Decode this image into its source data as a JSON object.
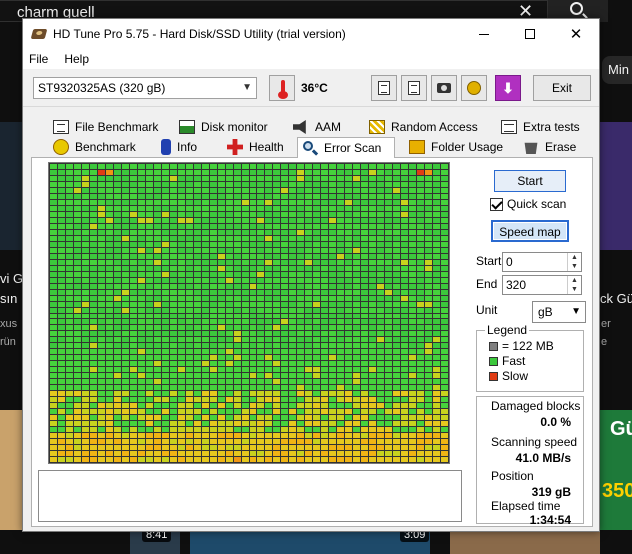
{
  "background": {
    "search_text": "charm guell",
    "chip_text": "Min",
    "left_video_title_1": "vi G",
    "left_video_title_2": "sın",
    "left_video_meta_1": "xus",
    "left_video_meta_2": "rün",
    "right_video_title": "ck Gü",
    "right_video_meta_1": "er",
    "right_video_meta_2": "e",
    "badge_left": "8:41",
    "badge_mid": "3:09",
    "right_thumb_text_1": "Gü",
    "right_thumb_text_2": "350"
  },
  "window": {
    "title": "HD Tune Pro 5.75 - Hard Disk/SSD Utility (trial version)",
    "menu": [
      "File",
      "Help"
    ],
    "close_glyph": "✕"
  },
  "toolbar": {
    "drive": "ST9320325AS (320 gB)",
    "temperature": "36°C",
    "exit_label": "Exit"
  },
  "tabs": {
    "row1": [
      "File Benchmark",
      "Disk monitor",
      "AAM",
      "Random Access",
      "Extra tests"
    ],
    "row2": [
      "Benchmark",
      "Info",
      "Health",
      "Error Scan",
      "Folder Usage",
      "Erase"
    ],
    "active": "Error Scan"
  },
  "error_scan": {
    "start_label": "Start",
    "quick_scan_label": "Quick scan",
    "quick_scan_checked": true,
    "speed_map_label": "Speed map",
    "start_field_label": "Start",
    "start_value": "0",
    "end_field_label": "End",
    "end_value": "320",
    "unit_label": "Unit",
    "unit_value": "gB",
    "legend_title": "Legend",
    "legend": [
      {
        "label": "= 122 MB",
        "color": "#808080"
      },
      {
        "label": "Fast",
        "color": "#3cc83c"
      },
      {
        "label": "Slow",
        "color": "#e03c14"
      }
    ],
    "stats": {
      "damaged_label": "Damaged blocks",
      "damaged_value": "0.0 %",
      "speed_label": "Scanning speed",
      "speed_value": "41.0 MB/s",
      "position_label": "Position",
      "position_value": "319 gB",
      "elapsed_label": "Elapsed time",
      "elapsed_value": "1:34:54"
    }
  },
  "colors": {
    "fast": "#3cc83c",
    "slow": "#e03c14",
    "accent": "#2a6ad0"
  }
}
